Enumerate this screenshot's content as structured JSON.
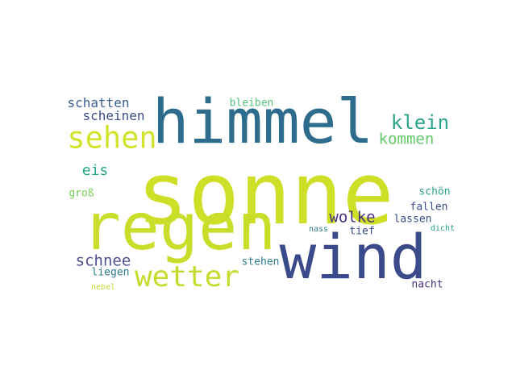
{
  "word_cloud": {
    "background": "#ffffff",
    "words": {
      "sonne": {
        "text": "sonne",
        "color": "#cddf26"
      },
      "himmel": {
        "text": "himmel",
        "color": "#2e6c8e"
      },
      "regen": {
        "text": "regen",
        "color": "#c9de2b"
      },
      "wind": {
        "text": "wind",
        "color": "#3b4a8a"
      },
      "sehen": {
        "text": "sehen",
        "color": "#d2e32c"
      },
      "wetter": {
        "text": "wetter",
        "color": "#c5dc2e"
      },
      "klein": {
        "text": "klein",
        "color": "#2aa38b"
      },
      "kommen": {
        "text": "kommen",
        "color": "#63c96a"
      },
      "schatten": {
        "text": "schatten",
        "color": "#3b5f8e"
      },
      "scheinen": {
        "text": "scheinen",
        "color": "#3e4d89"
      },
      "bleiben": {
        "text": "bleiben",
        "color": "#55c57a"
      },
      "eis": {
        "text": "eis",
        "color": "#25a68a"
      },
      "gross": {
        "text": "groß",
        "color": "#77d056"
      },
      "schoen": {
        "text": "schön",
        "color": "#2aa38b"
      },
      "wolke": {
        "text": "wolke",
        "color": "#4a2f7f"
      },
      "fallen": {
        "text": "fallen",
        "color": "#3b4a8a"
      },
      "lassen": {
        "text": "lassen",
        "color": "#3c4e8b"
      },
      "nass": {
        "text": "nass",
        "color": "#2e7d8e"
      },
      "tief": {
        "text": "tief",
        "color": "#3b4a8a"
      },
      "dicht": {
        "text": "dicht",
        "color": "#2aa38b"
      },
      "schnee": {
        "text": "schnee",
        "color": "#4f4f8f"
      },
      "liegen": {
        "text": "liegen",
        "color": "#2e7d8e"
      },
      "stehen": {
        "text": "stehen",
        "color": "#2e7d8e"
      },
      "nebel": {
        "text": "nebel",
        "color": "#c7dd3a"
      },
      "nacht": {
        "text": "nacht",
        "color": "#4a2f7f"
      }
    }
  }
}
